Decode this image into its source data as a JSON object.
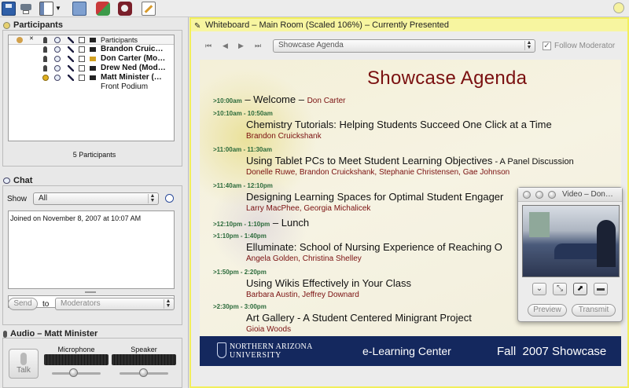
{
  "toolbar": {
    "icons": [
      "save-icon",
      "print-icon",
      "layout-icon",
      "presenter-icon",
      "plugin-icon",
      "record-icon",
      "edit-icon",
      "help-icon"
    ]
  },
  "participants": {
    "title": "Participants",
    "header": "Participants",
    "rows": [
      {
        "name": "Brandon Cruic…"
      },
      {
        "name": "Don Carter (Mo…"
      },
      {
        "name": "Drew Ned (Mod…"
      },
      {
        "name": "Matt Minister (…"
      },
      {
        "name": "Front Podium"
      }
    ],
    "count": "5 Participants"
  },
  "chat": {
    "title": "Chat",
    "show_label": "Show",
    "show_value": "All",
    "log": "Joined on November 8, 2007 at 10:07 AM",
    "send_label": "Send",
    "to_label": "to",
    "recipient": "Moderators"
  },
  "audio": {
    "title": "Audio – Matt Minister",
    "talk_label": "Talk",
    "microphone_label": "Microphone",
    "speaker_label": "Speaker",
    "microphone_level": 0.45,
    "speaker_level": 0.5
  },
  "whiteboard": {
    "title": "Whiteboard – Main Room (Scaled 106%) – Currently Presented",
    "page_select": "Showcase Agenda",
    "follow_label": "Follow Moderator",
    "follow_checked": true
  },
  "slide": {
    "title": "Showcase Agenda",
    "items": [
      {
        "time": ">10:00am",
        "dash": " – ",
        "title": "Welcome – ",
        "presenter_inline": "Don Carter"
      },
      {
        "time": ">10:10am - 10:50am",
        "title": "Chemistry Tutorials: Helping Students Succeed One Click at a Time",
        "presenters": "Brandon Cruickshank"
      },
      {
        "time": ">11:00am - 11:30am",
        "title": "Using Tablet PCs to Meet Student Learning Objectives",
        "suffix": " - A Panel Discussion",
        "presenters": "Donelle Ruwe, Brandon Cruickshank, Stephanie Christensen, Gae Johnson"
      },
      {
        "time": ">11:40am - 12:10pm",
        "title": "Designing Learning Spaces for Optimal Student Engager",
        "presenters": "Larry MacPhee, Georgia Michalicek"
      },
      {
        "time": ">12:10pm - 1:10pm",
        "dash": " – ",
        "title": "Lunch"
      },
      {
        "time": ">1:10pm - 1:40pm",
        "title": "Elluminate: School of Nursing Experience of Reaching O",
        "presenters": "Angela Golden, Christina Shelley"
      },
      {
        "time": ">1:50pm - 2:20pm",
        "title": "Using Wikis Effectively in Your Class",
        "presenters": "Barbara Austin, Jeffrey Downard"
      },
      {
        "time": ">2:30pm - 3:00pm",
        "title": "Art Gallery - A Student Centered Minigrant Project",
        "presenters": "Gioia Woods"
      }
    ],
    "footer": {
      "logo_line1": "NORTHERN ARIZONA",
      "logo_line2": "UNIVERSITY",
      "center": "e-Learning Center",
      "right": "Fall  2007 Showcase"
    }
  },
  "video": {
    "title": "Video – Don…",
    "preview_label": "Preview",
    "transmit_label": "Transmit"
  },
  "colors": {
    "accent_yellow": "#f2ef5b",
    "slide_title": "#7a1010",
    "time_green": "#2b6a3a",
    "footer_navy": "#14285e"
  }
}
